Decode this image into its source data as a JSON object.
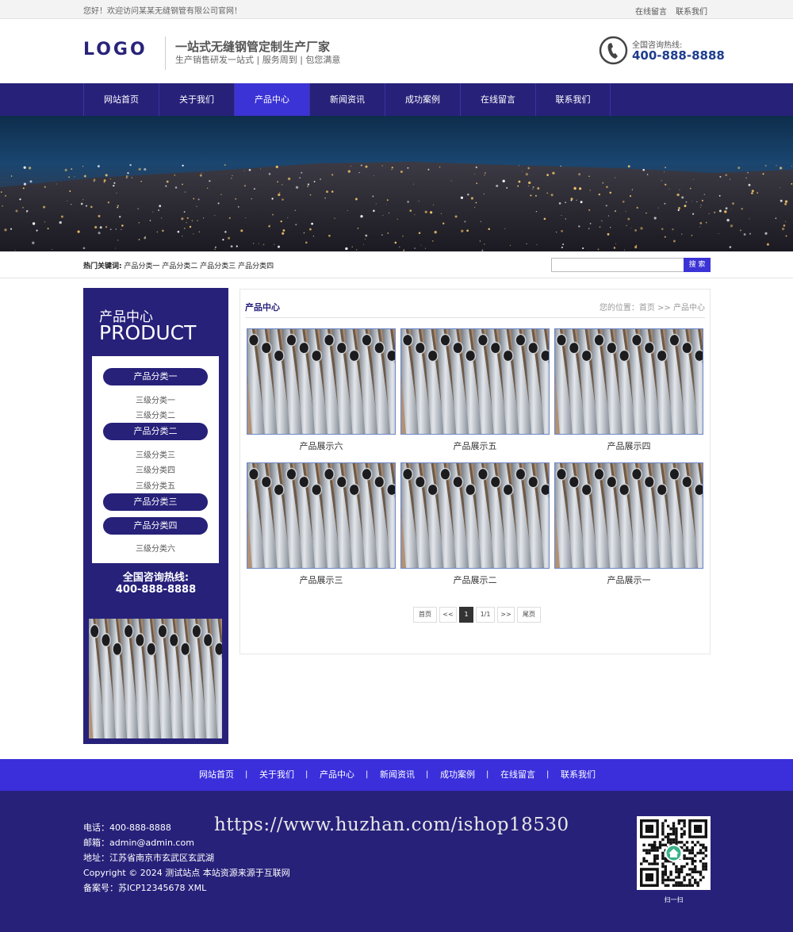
{
  "topbar": {
    "welcome": "您好！欢迎访问某某无缝钢管有限公司官网！",
    "links": [
      "在线留言",
      "联系我们"
    ]
  },
  "header": {
    "logo": "LOGO",
    "slogan": "一站式无缝钢管定制生产厂家",
    "subslogan": "生产销售研发一站式 | 服务周到 | 包您满意",
    "hotline_label": "全国咨询热线:",
    "hotline_number": "400-888-8888",
    "phone_icon": "phone-icon"
  },
  "nav": {
    "items": [
      "网站首页",
      "关于我们",
      "产品中心",
      "新闻资讯",
      "成功案例",
      "在线留言",
      "联系我们"
    ],
    "active": "产品中心"
  },
  "search": {
    "hot_label": "热门关键词:",
    "keywords": [
      "产品分类一",
      "产品分类二",
      "产品分类三",
      "产品分类四"
    ],
    "placeholder": "",
    "button": "搜 索"
  },
  "sidebar": {
    "title": "产品中心",
    "title_en": "PRODUCT",
    "categories": [
      {
        "label": "产品分类一",
        "subs": [
          "三级分类一",
          "三级分类二"
        ]
      },
      {
        "label": "产品分类二",
        "subs": [
          "三级分类三",
          "三级分类四",
          "三级分类五"
        ]
      },
      {
        "label": "产品分类三",
        "subs": []
      },
      {
        "label": "产品分类四",
        "subs": [
          "三级分类六"
        ]
      }
    ],
    "hotline_label": "全国咨询热线:",
    "hotline_number": "400-888-8888"
  },
  "content": {
    "title": "产品中心",
    "breadcrumb": "您的位置：首页 >> 产品中心",
    "products": [
      "产品展示六",
      "产品展示五",
      "产品展示四",
      "产品展示三",
      "产品展示二",
      "产品展示一"
    ],
    "pagination": {
      "first": "首页",
      "prev": "<<",
      "current": "1",
      "info": "1/1",
      "next": ">>",
      "last": "尾页"
    }
  },
  "footer": {
    "nav": [
      "网站首页",
      "关于我们",
      "产品中心",
      "新闻资讯",
      "成功案例",
      "在线留言",
      "联系我们"
    ],
    "separator": "|",
    "phone": "电话：400-888-8888",
    "email": "邮箱：admin@admin.com",
    "address": "地址：江苏省南京市玄武区玄武湖",
    "copyright": "Copyright © 2024 测试站点 本站资源来源于互联网",
    "icp": "备案号：苏ICP12345678 XML",
    "watermark": "https://www.huzhan.com/ishop18530",
    "qr_caption": "扫一扫",
    "qr_icon": "qr-code-icon"
  },
  "colors": {
    "primary": "#27217a",
    "accent": "#3c33d6",
    "footer_nav": "#3a2fdb"
  }
}
